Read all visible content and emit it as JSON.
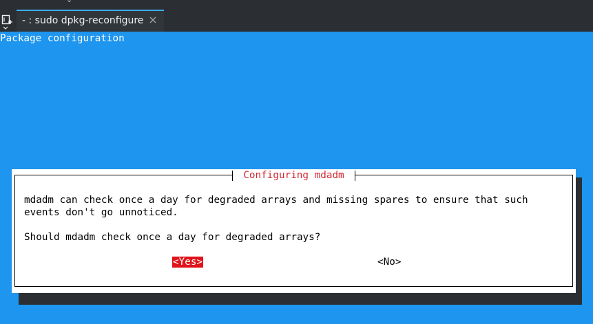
{
  "tab": {
    "title": "- : sudo dpkg-reconfigure"
  },
  "terminal": {
    "backtitle": "Package configuration",
    "dialog": {
      "title": "Configuring mdadm",
      "message_line_1": "mdadm can check once a day for degraded arrays and missing spares to ensure that such",
      "message_line_2": "events don't go unnoticed.",
      "question": "Should mdadm check once a day for degraded arrays?",
      "buttons": {
        "yes_label": "<Yes>",
        "no_label": "<No>"
      },
      "selected_button": "yes"
    }
  },
  "colors": {
    "terminal_background": "#1e95ee",
    "dialog_title": "#d22730",
    "selected_button_bg": "#e0131a",
    "tab_accent": "#3daee9"
  },
  "icons": {
    "new_tab": "new-tab-icon",
    "close_tab": "close-icon"
  }
}
